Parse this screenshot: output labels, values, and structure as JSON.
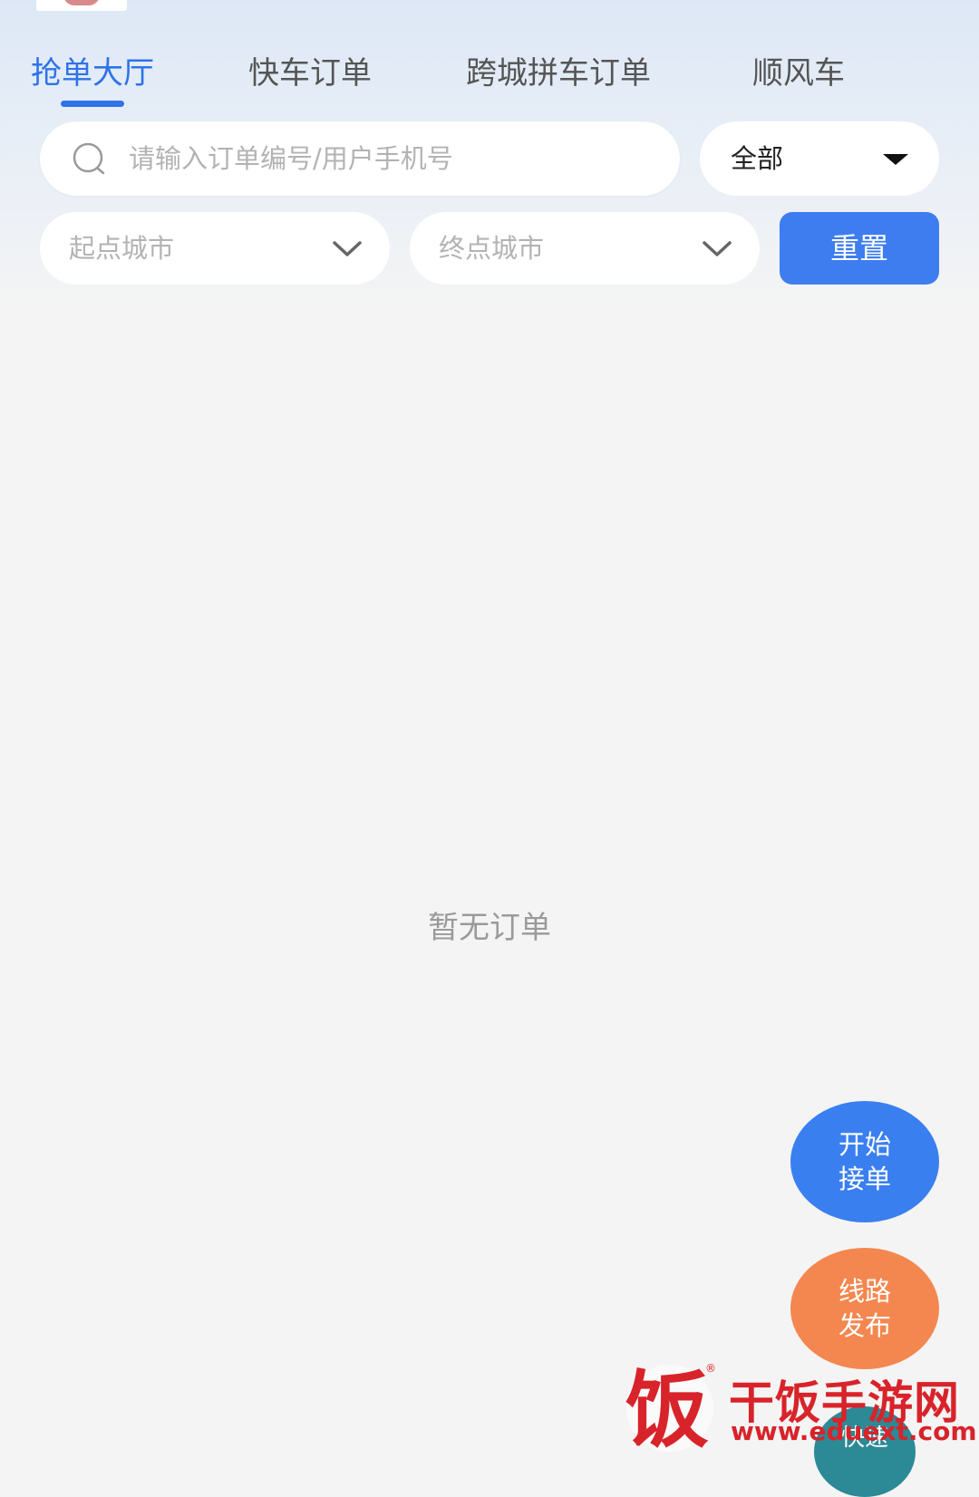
{
  "tabs": [
    {
      "label": "抢单大厅",
      "active": true
    },
    {
      "label": "快车订单",
      "active": false
    },
    {
      "label": "跨城拼车订单",
      "active": false
    },
    {
      "label": "顺风车",
      "active": false
    }
  ],
  "search": {
    "placeholder": "请输入订单编号/用户手机号",
    "value": ""
  },
  "type_filter": {
    "selected": "全部"
  },
  "city_filter": {
    "start_placeholder": "起点城市",
    "end_placeholder": "终点城市"
  },
  "reset_label": "重置",
  "empty_state": "暂无订单",
  "fab": {
    "start_line1": "开始",
    "start_line2": "接单",
    "route_line1": "线路",
    "route_line2": "发布",
    "third_label": "快速"
  },
  "watermark": {
    "brand": "干饭手游网",
    "url": "www.eduext.com",
    "logo_char": "饭"
  },
  "colors": {
    "accent": "#2f73e8",
    "reset_button": "#3d7df0",
    "start_fab": "#3a7ff0",
    "route_fab": "#f4874f",
    "watermark": "#d8232a"
  }
}
